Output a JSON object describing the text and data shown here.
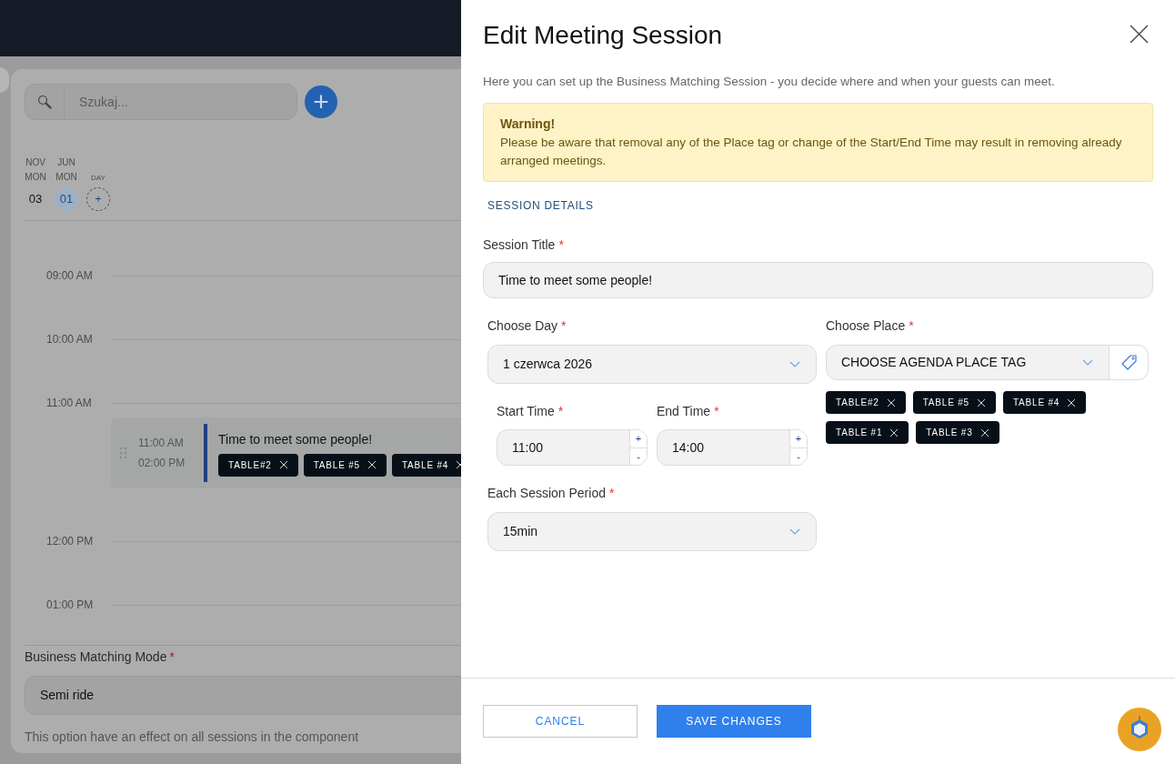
{
  "background": {
    "search": {
      "placeholder": "Szukaj..."
    },
    "add_button": "+",
    "days": [
      {
        "month": "NOV",
        "weekday": "MON",
        "date": "03",
        "selected": false
      },
      {
        "month": "JUN",
        "weekday": "MON",
        "date": "01",
        "selected": true
      }
    ],
    "add_day": {
      "label": "DAY",
      "icon": "+"
    },
    "time_slots": [
      {
        "time": "09:00 AM"
      },
      {
        "time": "10:00 AM"
      },
      {
        "time": "11:00 AM",
        "sessions": [
          {
            "start": "11:00 AM",
            "end": "02:00 PM",
            "title": "Time to meet some people!",
            "tags": [
              "TABLE#2",
              "TABLE #5",
              "TABLE #4"
            ]
          }
        ]
      },
      {
        "time": "12:00 PM"
      },
      {
        "time": "01:00 PM"
      }
    ],
    "mode": {
      "label": "Business Matching Mode",
      "required_mark": "*",
      "value": "Semi ride",
      "help": "This option have an effect on all sessions in the component"
    }
  },
  "dialog": {
    "title": "Edit Meeting Session",
    "description": "Here you can set up the Business Matching Session - you decide where and when your guests can meet.",
    "warning": {
      "title": "Warning!",
      "text": "Please be aware that removal any of the Place tag or change of the Start/End Time may result in removing already arranged meetings."
    },
    "section": "SESSION DETAILS",
    "session_title": {
      "label": "Session Title",
      "required_mark": "*",
      "value": "Time to meet some people!"
    },
    "day": {
      "label": "Choose Day",
      "required_mark": "*",
      "value": "1 czerwca 2026"
    },
    "start_time": {
      "label": "Start Time",
      "required_mark": "*",
      "value": "11:00",
      "increment": "+",
      "decrement": "-"
    },
    "end_time": {
      "label": "End Time",
      "required_mark": "*",
      "value": "14:00",
      "increment": "+",
      "decrement": "-"
    },
    "period": {
      "label": "Each Session Period",
      "required_mark": "*",
      "value": "15min"
    },
    "place": {
      "label": "Choose Place",
      "required_mark": "*",
      "value": "CHOOSE AGENDA PLACE TAG",
      "tags": [
        "TABLE#2",
        "TABLE #5",
        "TABLE #4",
        "TABLE #1",
        "TABLE #3"
      ]
    },
    "buttons": [
      {
        "label": "CANCEL",
        "kind": "secondary"
      },
      {
        "label": "SAVE CHANGES",
        "kind": "primary"
      }
    ]
  }
}
